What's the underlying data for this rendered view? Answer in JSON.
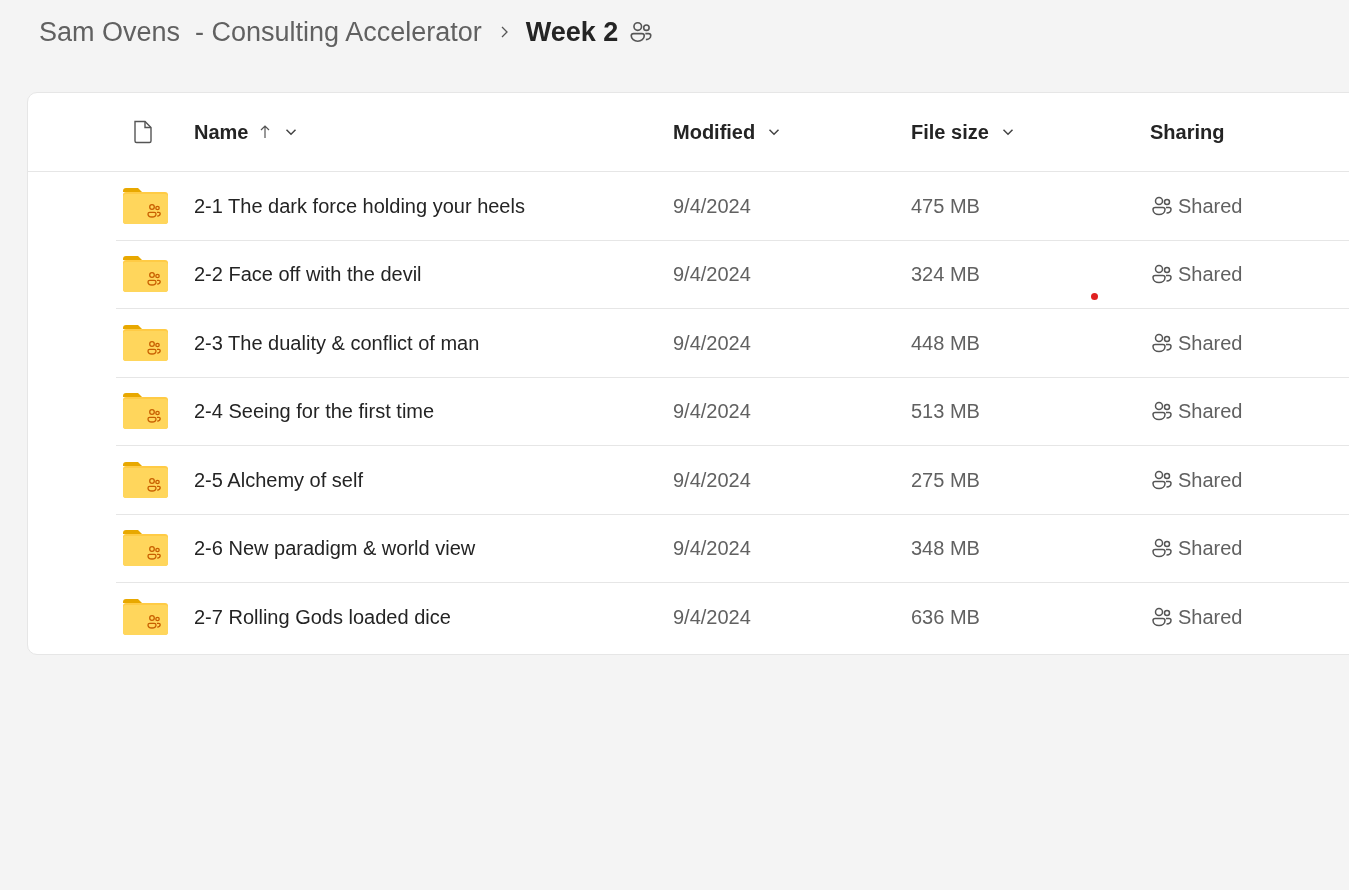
{
  "breadcrumb": {
    "items": [
      {
        "label": "Sam Ovens  - Consulting Accelerator",
        "current": false
      },
      {
        "label": "Week 2",
        "current": true
      }
    ],
    "shared": true
  },
  "table": {
    "columns": [
      {
        "label": "Name",
        "sorted": true,
        "menu": true
      },
      {
        "label": "Modified",
        "sorted": false,
        "menu": true
      },
      {
        "label": "File size",
        "sorted": false,
        "menu": true
      },
      {
        "label": "Sharing",
        "sorted": false,
        "menu": false
      }
    ],
    "rows": [
      {
        "name": "2-1 The dark force holding your heels",
        "modified": "9/4/2024",
        "size": "475 MB",
        "sharing": "Shared"
      },
      {
        "name": "2-2 Face off with the devil",
        "modified": "9/4/2024",
        "size": "324 MB",
        "sharing": "Shared"
      },
      {
        "name": "2-3 The duality & conflict of man",
        "modified": "9/4/2024",
        "size": "448 MB",
        "sharing": "Shared"
      },
      {
        "name": "2-4 Seeing for the first time",
        "modified": "9/4/2024",
        "size": "513 MB",
        "sharing": "Shared"
      },
      {
        "name": "2-5 Alchemy of self",
        "modified": "9/4/2024",
        "size": "275 MB",
        "sharing": "Shared"
      },
      {
        "name": "2-6 New paradigm & world view",
        "modified": "9/4/2024",
        "size": "348 MB",
        "sharing": "Shared"
      },
      {
        "name": "2-7 Rolling Gods loaded dice",
        "modified": "9/4/2024",
        "size": "636 MB",
        "sharing": "Shared"
      }
    ]
  }
}
